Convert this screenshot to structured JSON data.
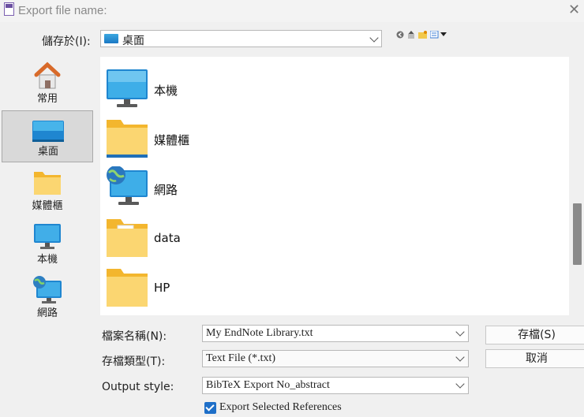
{
  "window": {
    "title": "Export file name:",
    "close": "✕"
  },
  "lookin": {
    "label": "儲存於(I):",
    "value": "桌面"
  },
  "places": [
    {
      "label": "常用",
      "icon": "home-icon"
    },
    {
      "label": "桌面",
      "icon": "desktop-icon"
    },
    {
      "label": "媒體櫃",
      "icon": "library-icon"
    },
    {
      "label": "本機",
      "icon": "computer-icon"
    },
    {
      "label": "網路",
      "icon": "network-icon"
    }
  ],
  "files": [
    {
      "name": "本機",
      "icon": "computer-icon"
    },
    {
      "name": "媒體櫃",
      "icon": "library-icon"
    },
    {
      "name": "網路",
      "icon": "network-icon"
    },
    {
      "name": "data",
      "icon": "folder-icon"
    },
    {
      "name": "HP",
      "icon": "folder-icon"
    }
  ],
  "form": {
    "filename_label": "檔案名稱(N):",
    "filename_value": "My EndNote Library.txt",
    "filetype_label": "存檔類型(T):",
    "filetype_value": "Text File (*.txt)",
    "style_label": "Output style:",
    "style_value": "BibTeX Export No_abstract",
    "save_label": "存檔(S)",
    "cancel_label": "取消",
    "export_selected_label": "Export Selected References",
    "export_selected_checked": true
  },
  "colors": {
    "selection": "#d9d9d9",
    "accent": "#1e6fc8"
  }
}
